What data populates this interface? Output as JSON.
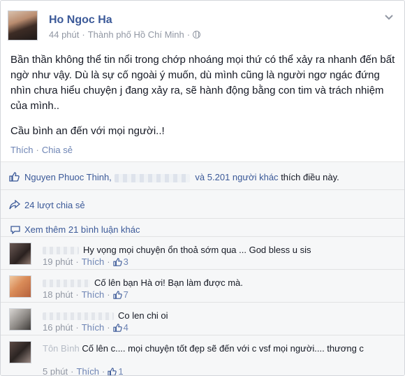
{
  "post": {
    "author": "Ho Ngoc Ha",
    "time": "44 phút",
    "separator": "·",
    "location": "Thành phố Hồ Chí Minh",
    "location_separator": "·",
    "paragraphs": [
      "Bần thần không thể tin nổi trong chớp nhoáng mọi thứ có thể xảy ra nhanh đến bất ngờ như vậy. Dù là sự cố ngoài ý muốn, dù mình cũng là người ngơ ngác đứng nhìn chưa hiểu chuyện j đang xảy ra, sẽ hành động bằng con tim và trách nhiệm của mình..",
      "Cầu bình an đến với mọi người..!"
    ],
    "action_like": "Thích",
    "action_separator": "·",
    "action_share": "Chia sẻ"
  },
  "feedback": {
    "likes_first": "Nguyen Phuoc Thinh,",
    "likes_and": "và 5.201 người khác",
    "likes_suffix": "thích điều này.",
    "shares": "24 lượt chia sẻ",
    "more_comments": "Xem thêm 21 bình luận khác"
  },
  "comments": [
    {
      "text": "Hy vọng mọi chuyện ổn thoả sớm qua ... God bless u sis",
      "time": "19 phút",
      "like_label": "Thích",
      "likes": "3"
    },
    {
      "text": "Cố lên bạn Hà ơi! Bạn làm được mà.",
      "time": "18 phút",
      "like_label": "Thích",
      "likes": "7"
    },
    {
      "text": "Co len chi oi",
      "time": "16 phút",
      "like_label": "Thích",
      "likes": "4"
    },
    {
      "name_partial": "Tôn Bình",
      "text": "Cố lên c.... mọi chuyện tốt đẹp sẽ đến với c vsf mọi người.... thương c",
      "time": "5 phút",
      "like_label": "Thích",
      "likes": "1"
    }
  ],
  "colors": {
    "link": "#3b5998",
    "muted": "#9197a3",
    "ufi_bg": "#f6f7f8"
  }
}
